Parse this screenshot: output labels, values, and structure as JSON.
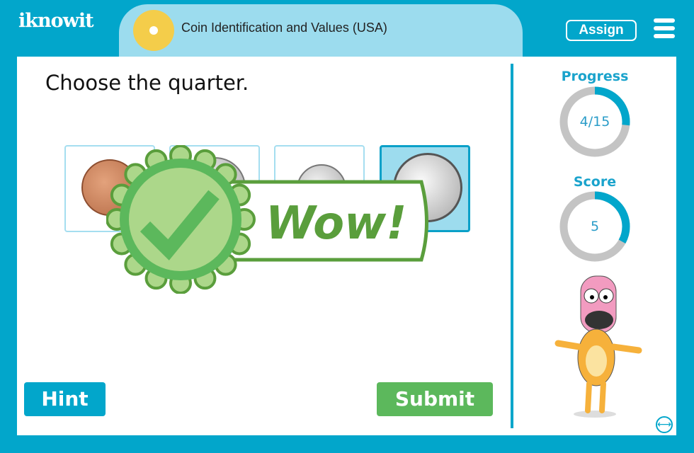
{
  "header": {
    "logo": "iknowit",
    "title": "Coin Identification and Values (USA)",
    "assign_label": "Assign"
  },
  "question": "Choose the quarter.",
  "choices": [
    {
      "coin": "penny"
    },
    {
      "coin": "nickel"
    },
    {
      "coin": "dime"
    },
    {
      "coin": "quarter",
      "selected": true
    }
  ],
  "feedback": {
    "text": "Wow!",
    "icon": "checkmark-badge-icon"
  },
  "buttons": {
    "hint": "Hint",
    "submit": "Submit"
  },
  "sidebar": {
    "progress_label": "Progress",
    "progress_text": "4/15",
    "progress_value": 4,
    "progress_total": 15,
    "score_label": "Score",
    "score_text": "5",
    "score_fraction": 0.33
  },
  "colors": {
    "brand": "#02a6cb",
    "success": "#5cb85c",
    "ring_bg": "#c4c4c4"
  }
}
